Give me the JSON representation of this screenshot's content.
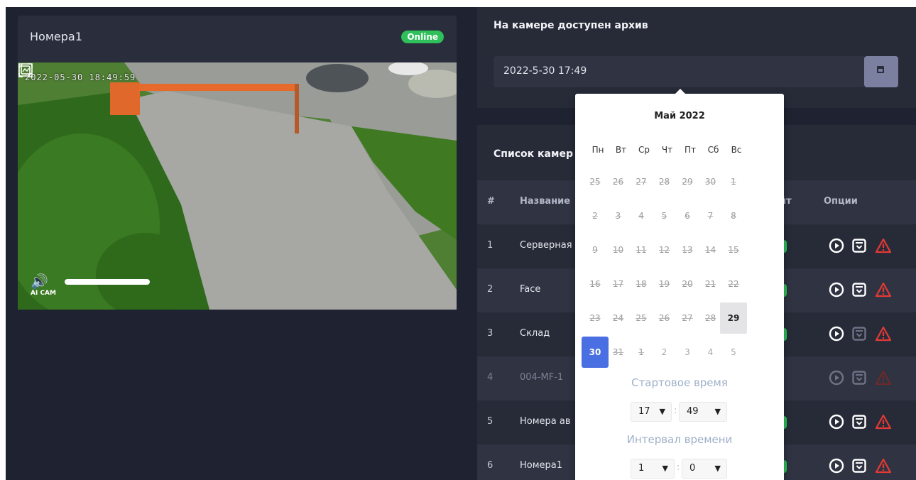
{
  "camera": {
    "title": "Номера1",
    "status": "Online",
    "osd_timestamp": "2022-05-30 18:49:59",
    "ai_label": "AI CAM",
    "controls": [
      "volume-icon",
      "snapshot-icon",
      "fullscreen-icon"
    ]
  },
  "archive": {
    "title": "На камере доступен архив",
    "date_value": "2022-5-30 17:49"
  },
  "camera_list": {
    "title": "Список камер",
    "columns": [
      "#",
      "Название",
      "йт",
      "Опции"
    ],
    "rows": [
      {
        "num": "1",
        "name": "Серверная"
      },
      {
        "num": "2",
        "name": "Face"
      },
      {
        "num": "3",
        "name": "Склад"
      },
      {
        "num": "4",
        "name": "004-MF-1"
      },
      {
        "num": "5",
        "name": "Номера ав"
      },
      {
        "num": "6",
        "name": "Номера1"
      }
    ]
  },
  "datepicker": {
    "month": "Май 2022",
    "weekdays": [
      "Пн",
      "Вт",
      "Ср",
      "Чт",
      "Пт",
      "Сб",
      "Вс"
    ],
    "weeks": [
      [
        "25",
        "26",
        "27",
        "28",
        "29",
        "30",
        "1"
      ],
      [
        "2",
        "3",
        "4",
        "5",
        "6",
        "7",
        "8"
      ],
      [
        "9",
        "10",
        "11",
        "12",
        "13",
        "14",
        "15"
      ],
      [
        "16",
        "17",
        "18",
        "19",
        "20",
        "21",
        "22"
      ],
      [
        "23",
        "24",
        "25",
        "26",
        "27",
        "28",
        "29"
      ],
      [
        "30",
        "31",
        "1",
        "2",
        "3",
        "4",
        "5"
      ]
    ],
    "available_day": "29",
    "selected_day": "30",
    "start_label": "Стартовое время",
    "start_hour": "17",
    "start_minute": "49",
    "interval_label": "Интервал времени",
    "interval_hour": "1",
    "interval_minute": "0"
  },
  "colors": {
    "background": "#1f2230",
    "panel": "#272b38",
    "online": "#2fbf5b",
    "selected": "#4a6fe3",
    "alert": "#e53935"
  }
}
